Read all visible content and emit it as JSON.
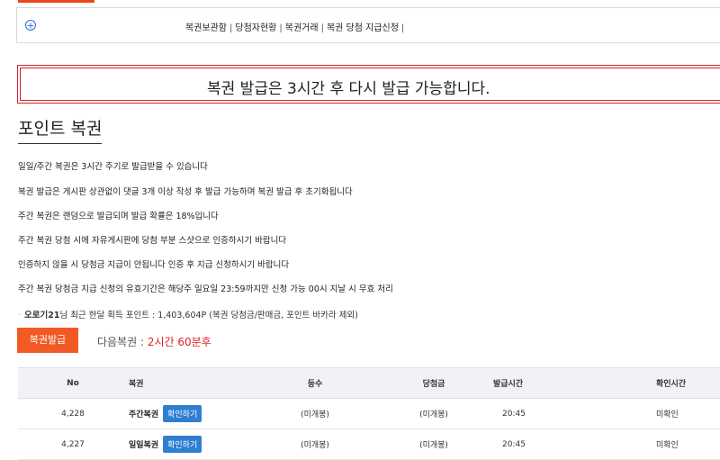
{
  "nav": {
    "links": [
      "복권보관함",
      "당첨자현황",
      "복권거래",
      "복권 당첨 지급신청"
    ],
    "trailing_sep": "|"
  },
  "alert": {
    "message": "복권 발급은 3시간 후 다시 발급 가능합니다."
  },
  "page": {
    "title": "포인트 복권"
  },
  "info_lines": [
    "일일/주간 복권은 3시간 주기로 발급받을 수 있습니다",
    "복권 발급은 게시판 상관없이 댓글 3개 이상 작성 후 발급 가능하며 복권 발급 후 초기화됩니다",
    "주간 복권은 랜덤으로 발급되며 발급 확률은 18%입니다",
    "주간 복권 당첨 시에 자유게시판에 당첨 부분 스샷으로 인증하시기 바랍니다",
    "인증하지 않을 시 당첨금 지급이 안됩니다 인증 후 지급 신청하시기 바랍니다",
    "주간 복권 당첨금 지급 신청의 유효기간은 해당주 일요일 23:59까지만 신청 가능 00시 지날 시 무효 처리"
  ],
  "points": {
    "user": "오로기21",
    "text": "님 최근 한달 획득 포인트 : 1,403,604P (복권 당첨금/판매금, 포인트 바카라 제외)"
  },
  "actions": {
    "issue_button": "복권발급",
    "next_label": "다음복권 : ",
    "next_value": "2시간 60분후"
  },
  "table": {
    "headers": [
      "No",
      "복권",
      "등수",
      "당첨금",
      "발급시간",
      "확인시간"
    ],
    "rows": [
      {
        "no": "4,228",
        "ticket": "주간복권",
        "check_btn": "확인하기",
        "grade": "(미개봉)",
        "prize": "(미개봉)",
        "issued": "20:45",
        "checked": "미확인"
      },
      {
        "no": "4,227",
        "ticket": "일일복권",
        "check_btn": "확인하기",
        "grade": "(미개봉)",
        "prize": "(미개봉)",
        "issued": "20:45",
        "checked": "미확인"
      }
    ]
  },
  "colors": {
    "accent": "#f15a24",
    "alert_border": "#c9252b",
    "link_button": "#2f7fd1",
    "unconfirmed": "#e8a020"
  }
}
